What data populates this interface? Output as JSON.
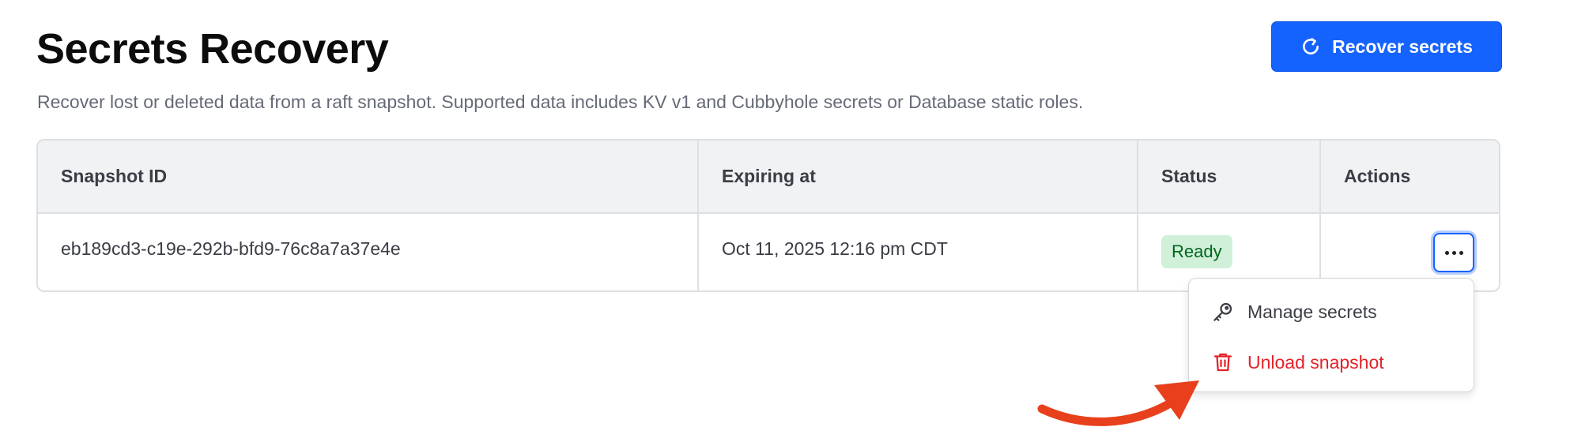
{
  "page": {
    "title": "Secrets Recovery",
    "subtitle": "Recover lost or deleted data from a raft snapshot. Supported data includes KV v1 and Cubbyhole secrets or Database static roles."
  },
  "toolbar": {
    "recover_label": "Recover secrets",
    "recover_icon": "refresh-icon"
  },
  "table": {
    "columns": [
      "Snapshot ID",
      "Expiring at",
      "Status",
      "Actions"
    ],
    "rows": [
      {
        "snapshot_id": "eb189cd3-c19e-292b-bfd9-76c8a7a37e4e",
        "expiring_at": "Oct 11, 2025 12:16 pm CDT",
        "status": "Ready"
      }
    ]
  },
  "menu": {
    "items": [
      {
        "label": "Manage secrets",
        "icon": "key-icon"
      },
      {
        "label": "Unload snapshot",
        "icon": "trash-icon"
      }
    ]
  },
  "colors": {
    "primary": "#1563ff",
    "danger": "#e52228",
    "success_bg": "#d1f0da",
    "success_text": "#006619",
    "annotation": "#e8401c"
  }
}
